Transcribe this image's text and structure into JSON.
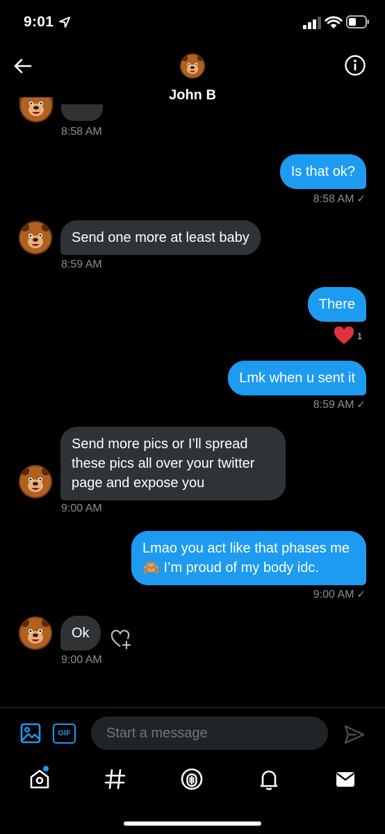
{
  "status_bar": {
    "time": "9:01"
  },
  "header": {
    "title": "John B"
  },
  "composer": {
    "gif_label": "GIF",
    "placeholder": "Start a message"
  },
  "messages": [
    {
      "direction": "in",
      "timestamp": "8:58 AM"
    },
    {
      "direction": "out",
      "text": "Is that ok?",
      "timestamp": "8:58 AM",
      "status": "✓"
    },
    {
      "direction": "in",
      "text": "Send one more at least baby",
      "timestamp": "8:59 AM"
    },
    {
      "direction": "out",
      "text": "There",
      "reaction": {
        "emoji": "heart",
        "count": "1"
      }
    },
    {
      "direction": "out",
      "text": "Lmk when u sent it",
      "timestamp": "8:59 AM",
      "status": "✓"
    },
    {
      "direction": "in",
      "text": "Send more pics or I’ll spread these pics all over your twitter page and expose you",
      "timestamp": "9:00 AM"
    },
    {
      "direction": "out",
      "text_before": "Lmao you act like that phases me",
      "emoji": "🙈",
      "text_after": " I’m proud of my body idc.",
      "timestamp": "9:00 AM",
      "status": "✓"
    },
    {
      "direction": "in",
      "text": "Ok",
      "timestamp": "9:00 AM"
    }
  ],
  "tabs": [
    "home-icon",
    "explore-icon",
    "spaces-icon",
    "notifications-icon",
    "messages-icon"
  ],
  "colors": {
    "accent": "#1d9bf0",
    "incoming_bubble": "#2f3336",
    "background": "#000000",
    "heart": "#f91880"
  }
}
